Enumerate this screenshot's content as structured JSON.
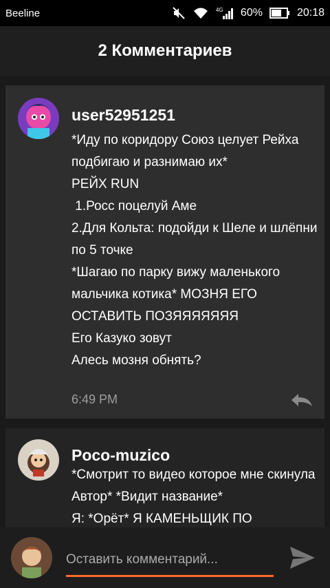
{
  "status_bar": {
    "carrier": "Beeline",
    "network": "4G",
    "battery": "60%",
    "time": "20:18",
    "icons": [
      "mute-icon",
      "wifi-icon",
      "signal-icon",
      "battery-icon"
    ]
  },
  "header": {
    "title": "2 Комментариев"
  },
  "comments": [
    {
      "username": "user52951251",
      "avatar_icon": "anime-avatar",
      "text": "*Иду по коридору Союз целует Рейха подбигаю и разнимаю их*\nРЕЙХ RUN\n 1.Росс поцелуй Аме\n2.Для Кольта: подойди к Шеле и шлёпни по 5 точке\n*Шагаю по парку вижу маленького мальчика котика* МОЗНЯ ЕГО ОСТАВИТЬ ПОЗЯЯЯЯЯЯЯ\nЕго Казуко зовут\nАлесь мозня обнять?",
      "time": "6:49 PM",
      "reply_icon": "reply-icon"
    },
    {
      "username": "Poco-muzico",
      "avatar_icon": "character-avatar",
      "text": "*Смотрит то видео которое мне скинула Автор* *Видит название*\nЯ: *Орёт* Я КАМЕНЬЩИК ПО"
    }
  ],
  "input": {
    "placeholder": "Оставить комментарий...",
    "send_icon": "send-icon"
  },
  "colors": {
    "accent": "#ff6a2c",
    "card": "#2e2e2e",
    "background": "#1a1a1a",
    "timestamp": "#9e9e9e"
  }
}
